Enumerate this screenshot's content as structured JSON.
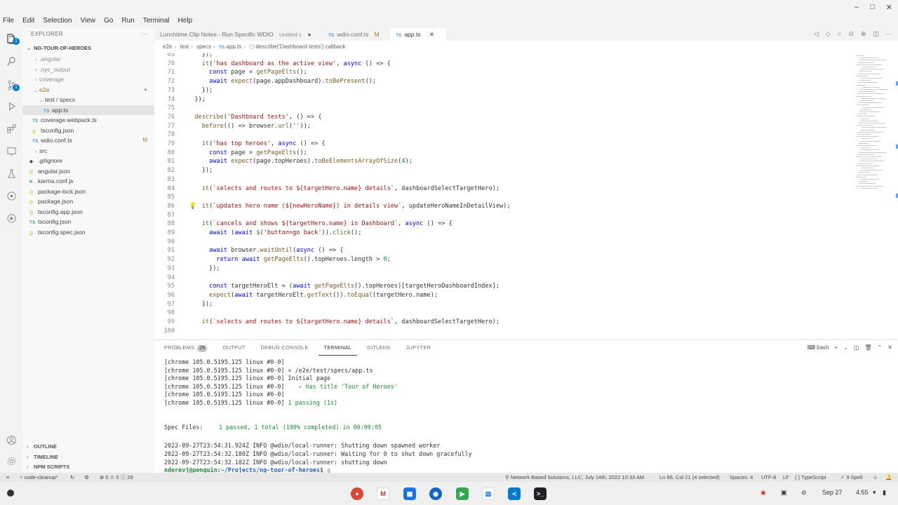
{
  "menu": [
    "File",
    "Edit",
    "Selection",
    "View",
    "Go",
    "Run",
    "Terminal",
    "Help"
  ],
  "window_controls": [
    "–",
    "□",
    "✕"
  ],
  "activity": {
    "explorer_badge": "1",
    "scm_badge": "1"
  },
  "sidebar": {
    "title": "EXPLORER",
    "more": "···",
    "root": "NG-TOUR-OF-HEROES",
    "items": [
      {
        "label": ".angular",
        "chev": "›",
        "icon": "",
        "status": ""
      },
      {
        "label": ".nyc_output",
        "chev": "›",
        "icon": "",
        "status": ""
      },
      {
        "label": "coverage",
        "chev": "›",
        "icon": "",
        "status": ""
      },
      {
        "label": "e2e",
        "chev": "⌄",
        "icon": "",
        "status": "●"
      },
      {
        "label": "test / specs",
        "chev": "⌄",
        "icon": "",
        "status": ""
      },
      {
        "label": "app.ts",
        "chev": "",
        "icon": "TS",
        "status": ""
      },
      {
        "label": "coverage.webpack.ts",
        "chev": "",
        "icon": "TS",
        "status": ""
      },
      {
        "label": "tsconfig.json",
        "chev": "",
        "icon": "{}",
        "status": ""
      },
      {
        "label": "wdio.conf.ts",
        "chev": "",
        "icon": "TS",
        "status": "M"
      },
      {
        "label": "src",
        "chev": "›",
        "icon": "",
        "status": ""
      },
      {
        "label": ".gitignore",
        "chev": "",
        "icon": "◆",
        "status": ""
      },
      {
        "label": "angular.json",
        "chev": "",
        "icon": "{}",
        "status": ""
      },
      {
        "label": "karma.conf.js",
        "chev": "",
        "icon": "K",
        "status": ""
      },
      {
        "label": "package-lock.json",
        "chev": "",
        "icon": "{}",
        "status": ""
      },
      {
        "label": "package.json",
        "chev": "",
        "icon": "{}",
        "status": ""
      },
      {
        "label": "tsconfig.app.json",
        "chev": "",
        "icon": "{}",
        "status": ""
      },
      {
        "label": "tsconfig.json",
        "chev": "",
        "icon": "TS",
        "status": ""
      },
      {
        "label": "tsconfig.spec.json",
        "chev": "",
        "icon": "{}",
        "status": ""
      }
    ],
    "sections": [
      "OUTLINE",
      "TIMELINE",
      "NPM SCRIPTS"
    ]
  },
  "tabs": [
    {
      "label": "Lunchtime Clip Notes - Run Specific WDIO",
      "suffix": "Untitled-1",
      "mark": "●"
    },
    {
      "label": "wdio.conf.ts",
      "suffix": "",
      "mark": "M"
    },
    {
      "label": "app.ts",
      "suffix": "",
      "mark": ""
    }
  ],
  "tab_close": "✕",
  "ts_label": "TS",
  "breadcrumbs": [
    "e2e",
    "test",
    "specs",
    "app.ts",
    "describe('Dashboard tests') callback"
  ],
  "editor": {
    "line_numbers": [
      "69",
      "70",
      "71",
      "72",
      "73",
      "74",
      "75",
      "76",
      "77",
      "78",
      "79",
      "80",
      "81",
      "82",
      "83",
      "84",
      "85",
      "86",
      "87",
      "88",
      "89",
      "90",
      "91",
      "92",
      "93",
      "94",
      "95",
      "96",
      "97",
      "98",
      "99",
      "100"
    ],
    "lines": [
      "    });",
      "    it('has dashboard as the active view', async () => {",
      "      const page = getPageElts();",
      "      await expect(page.appDashboard).toBePresent();",
      "    });",
      "  });",
      "",
      "  describe('Dashboard tests', () => {",
      "    before(() => browser.url(''));",
      "",
      "    it('has top heroes', async () => {",
      "      const page = getPageElts();",
      "      await expect(page.topHeroes).toBeElementsArrayOfSize(4);",
      "    });",
      "",
      "    it(`selects and routes to ${targetHero.name} details`, dashboardSelectTargetHero);",
      "",
      "    it(`updates hero name (${newHeroName}) in details view`, updateHeroNameInDetailView);",
      "",
      "    it(`cancels and shows ${targetHero.name} in Dashboard`, async () => {",
      "      await (await $('button=go back')).click();",
      "",
      "      await browser.waitUntil(async () => {",
      "        return await getPageElts().topHeroes.length > 0;",
      "      });",
      "",
      "      const targetHeroElt = (await getPageElts().topHeroes)[targetHeroDashboardIndex];",
      "      expect(await targetHeroElt.getText()).toEqual(targetHero.name);",
      "    });",
      "",
      "    it(`selects and routes to ${targetHero.name} details`, dashboardSelectTargetHero);",
      ""
    ]
  },
  "panel": {
    "tabs": [
      "PROBLEMS",
      "OUTPUT",
      "DEBUG CONSOLE",
      "TERMINAL",
      "GITLENS",
      "JUPYTER"
    ],
    "problems_count": "29",
    "shell": "bash",
    "terminal": [
      {
        "prefix": "[chrome 105.0.5195.125 linux #0-0]",
        "text": ""
      },
      {
        "prefix": "[chrome 105.0.5195.125 linux #0-0]",
        "text": " » /e2e/test/specs/app.ts"
      },
      {
        "prefix": "[chrome 105.0.5195.125 linux #0-0]",
        "text": " Initial page"
      },
      {
        "prefix": "[chrome 105.0.5195.125 linux #0-0]",
        "text": "    ✓ has title 'Tour of Heroes'"
      },
      {
        "prefix": "[chrome 105.0.5195.125 linux #0-0]",
        "text": ""
      },
      {
        "prefix": "[chrome 105.0.5195.125 linux #0-0]",
        "text": " 1 passing (1s)"
      }
    ],
    "spec_files_label": "Spec Files:",
    "spec_files_result": "1 passed, 1 total (100% completed) in 00:00:05",
    "logs": [
      {
        "ts": "2022-09-27T23:54:31.924Z",
        "level": "INFO",
        "src": "@wdio/local-runner:",
        "msg": "Shutting down spawned worker"
      },
      {
        "ts": "2022-09-27T23:54:32.180Z",
        "level": "INFO",
        "src": "@wdio/local-runner:",
        "msg": "Waiting for 0 to shut down gracefully"
      },
      {
        "ts": "2022-09-27T23:54:32.182Z",
        "level": "INFO",
        "src": "@wdio/local-runner:",
        "msg": "shutting down"
      }
    ],
    "prompt_user": "nderevj@penguin",
    "prompt_path": ":~/Projects/ng-tour-of-heroes",
    "prompt_symbol": "$"
  },
  "status": {
    "branch": "code-cleanup*",
    "problems": "⊗ 0 ⚠ 0 ⓘ 29",
    "blame": "Network Based Solutions, LLC, July 14th, 2022 10:33 AM",
    "position": "Ln 86, Col 21 (4 selected)",
    "spaces": "Spaces: 4",
    "encoding": "UTF-8",
    "eol": "LF",
    "language": "TypeScript",
    "spell": "9 Spell"
  },
  "shelf": {
    "date": "Sep 27",
    "time": "4:55"
  },
  "colors": {
    "accent": "#007acc",
    "keyword": "#0000ff",
    "string": "#a31515",
    "function": "#795e26",
    "terminal_green": "#1e8a3a"
  }
}
